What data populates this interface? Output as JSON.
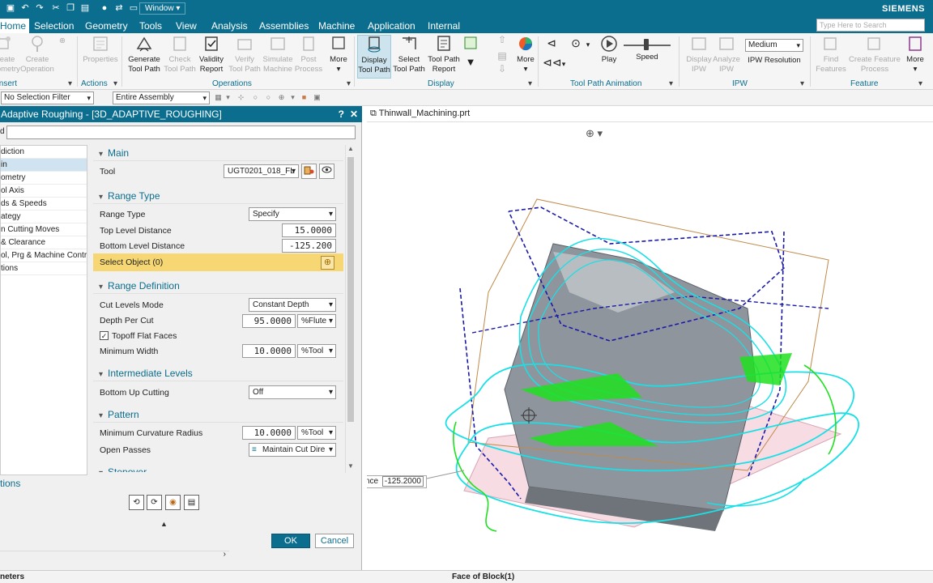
{
  "titlebar": {
    "window_menu": "Window ▾",
    "brand": "SIEMENS"
  },
  "tabs": {
    "items": [
      "Home",
      "Selection",
      "Geometry",
      "Tools",
      "View",
      "Analysis",
      "Assemblies",
      "Machine",
      "Application",
      "Internal"
    ],
    "search_placeholder": "Type Here to Search"
  },
  "ribbon": {
    "insert": {
      "b1": "Create\nGeometry",
      "b2": "Create\nOperation",
      "group": "Insert"
    },
    "actions": {
      "properties": "Properties",
      "group": "Actions"
    },
    "operations": {
      "generate": "Generate\nTool Path",
      "check": "Check\nTool Path",
      "validity": "Validity\nReport",
      "verify": "Verify\nTool Path",
      "simulate": "Simulate\nMachine",
      "post": "Post\nProcess",
      "more": "More",
      "group": "Operations"
    },
    "display": {
      "display_tp": "Display\nTool Path",
      "select_tp": "Select\nTool Path",
      "tp_report": "Tool Path\nReport",
      "more": "More",
      "group": "Display"
    },
    "animation": {
      "play": "Play",
      "speed": "Speed",
      "group": "Tool Path Animation"
    },
    "ipw": {
      "display": "Display\nIPW",
      "analyze": "Analyze\nIPW",
      "resolution_value": "Medium",
      "resolution_label": "IPW Resolution",
      "group": "IPW"
    },
    "feature": {
      "find": "Find\nFeatures",
      "create": "Create Feature\nProcess",
      "more": "More",
      "group": "Feature"
    }
  },
  "selection_bar": {
    "filter": "No Selection Filter",
    "scope": "Entire Assembly"
  },
  "dialog": {
    "title": "Adaptive Roughing - [3D_ADAPTIVE_ROUGHING]",
    "help": "?",
    "close": "✕",
    "name_label": "d",
    "nav_items": [
      "diction",
      "in",
      "ometry",
      "ol Axis",
      "ds & Speeds",
      "ategy",
      "n Cutting Moves",
      " & Clearance",
      "ol, Prg & Machine Contro",
      "tions"
    ],
    "sections": {
      "main": "Main",
      "range_type": "Range Type",
      "range_definition": "Range Definition",
      "intermediate_levels": "Intermediate Levels",
      "pattern": "Pattern",
      "stepover": "Stepover"
    },
    "fields": {
      "tool_label": "Tool",
      "tool_value": "UGT0201_018_FL",
      "range_type_label": "Range Type",
      "range_type_value": "Specify",
      "top_level_label": "Top Level Distance",
      "top_level_value": "15.0000",
      "bottom_level_label": "Bottom Level Distance",
      "bottom_level_value": "-125.200",
      "select_object": "Select Object (0)",
      "cut_levels_label": "Cut Levels Mode",
      "cut_levels_value": "Constant Depth",
      "depth_label": "Depth Per Cut",
      "depth_value": "95.0000",
      "depth_unit": "%Flute",
      "topoff_label": "Topoff Flat Faces",
      "min_width_label": "Minimum Width",
      "min_width_value": "10.0000",
      "min_width_unit": "%Tool",
      "bottom_up_label": "Bottom Up Cutting",
      "bottom_up_value": "Off",
      "min_curv_label": "Minimum Curvature Radius",
      "min_curv_value": "10.0000",
      "min_curv_unit": "%Tool",
      "open_passes_label": "Open Passes",
      "open_passes_value": "Maintain Cut Dire"
    },
    "options_link": "tions",
    "ok": "OK",
    "cancel": "Cancel"
  },
  "viewport": {
    "doc_tab": "Thinwall_Machining.prt",
    "dist_prefix": "nce",
    "dist_value": "-125.2000"
  },
  "status": {
    "left": "neters",
    "middle": "Face of Block(1)"
  },
  "colors": {
    "accent": "#0b6e8f",
    "toolpath_cyan": "#19e0e6",
    "toolpath_green": "#1ee01e",
    "bounds_blue": "#1a1aa8",
    "highlight_yellow": "#f7d774"
  }
}
